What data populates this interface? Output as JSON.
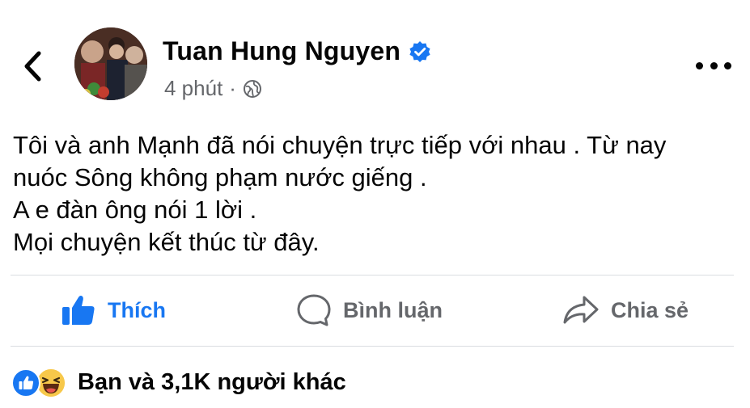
{
  "header": {
    "back_icon": "chevron-left-icon",
    "author_name": "Tuan Hung Nguyen",
    "verified_icon": "verified-badge-icon",
    "time": "4 phút",
    "separator": "·",
    "privacy_icon": "globe-icon",
    "more_icon": "more-horizontal-icon"
  },
  "post": {
    "lines": [
      "Tôi và anh Mạnh đã nói chuyện trực tiếp với nhau .  Từ nay",
      "nuóc Sông không phạm nước giếng .",
      "A e đàn ông nói 1 lời .",
      "Mọi chuyện kết thúc từ đây."
    ]
  },
  "actions": {
    "like_label": "Thích",
    "comment_label": "Bình luận",
    "share_label": "Chia sẻ"
  },
  "reactions": {
    "text": "Bạn và 3,1K người khác",
    "icons": [
      "like-reaction-icon",
      "haha-reaction-icon"
    ]
  },
  "colors": {
    "accent": "#1877f2",
    "secondary_text": "#65676b",
    "primary_text": "#050505",
    "divider": "#dadde1"
  }
}
